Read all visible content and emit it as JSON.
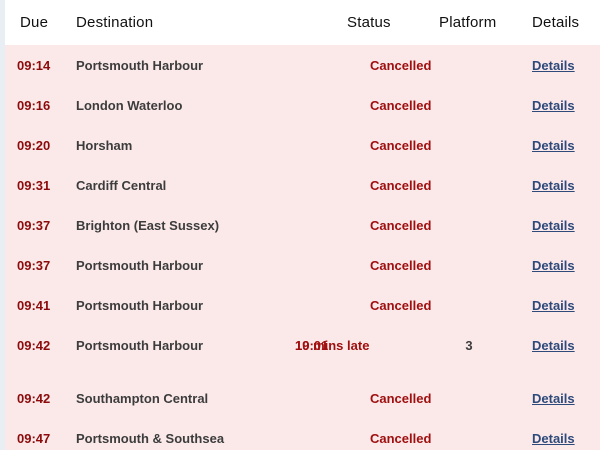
{
  "columns": {
    "due": "Due",
    "destination": "Destination",
    "status": "Status",
    "platform": "Platform",
    "details": "Details"
  },
  "rows": [
    {
      "due": "09:14",
      "destination": "Portsmouth Harbour",
      "status": "Cancelled",
      "status_note": "",
      "platform": "",
      "details": "Details"
    },
    {
      "due": "09:16",
      "destination": "London Waterloo",
      "status": "Cancelled",
      "status_note": "",
      "platform": "",
      "details": "Details"
    },
    {
      "due": "09:20",
      "destination": "Horsham",
      "status": "Cancelled",
      "status_note": "",
      "platform": "",
      "details": "Details"
    },
    {
      "due": "09:31",
      "destination": "Cardiff Central",
      "status": "Cancelled",
      "status_note": "",
      "platform": "",
      "details": "Details"
    },
    {
      "due": "09:37",
      "destination": "Brighton (East Sussex)",
      "status": "Cancelled",
      "status_note": "",
      "platform": "",
      "details": "Details"
    },
    {
      "due": "09:37",
      "destination": "Portsmouth Harbour",
      "status": "Cancelled",
      "status_note": "",
      "platform": "",
      "details": "Details"
    },
    {
      "due": "09:41",
      "destination": "Portsmouth Harbour",
      "status": "Cancelled",
      "status_note": "",
      "platform": "",
      "details": "Details"
    },
    {
      "due": "09:42",
      "destination": "Portsmouth Harbour",
      "status": "10:01",
      "status_note": "19 mins late",
      "platform": "3",
      "details": "Details"
    },
    {
      "due": "09:42",
      "destination": "Southampton Central",
      "status": "Cancelled",
      "status_note": "",
      "platform": "",
      "details": "Details"
    },
    {
      "due": "09:47",
      "destination": "Portsmouth & Southsea",
      "status": "Cancelled",
      "status_note": "",
      "platform": "",
      "details": "Details"
    }
  ],
  "colors": {
    "header_bg": "#ffffff",
    "row_bg": "#fbe9ea",
    "due_text": "#8c0a0a",
    "status_text": "#a00f0f",
    "link_text": "#2d4a7a"
  }
}
